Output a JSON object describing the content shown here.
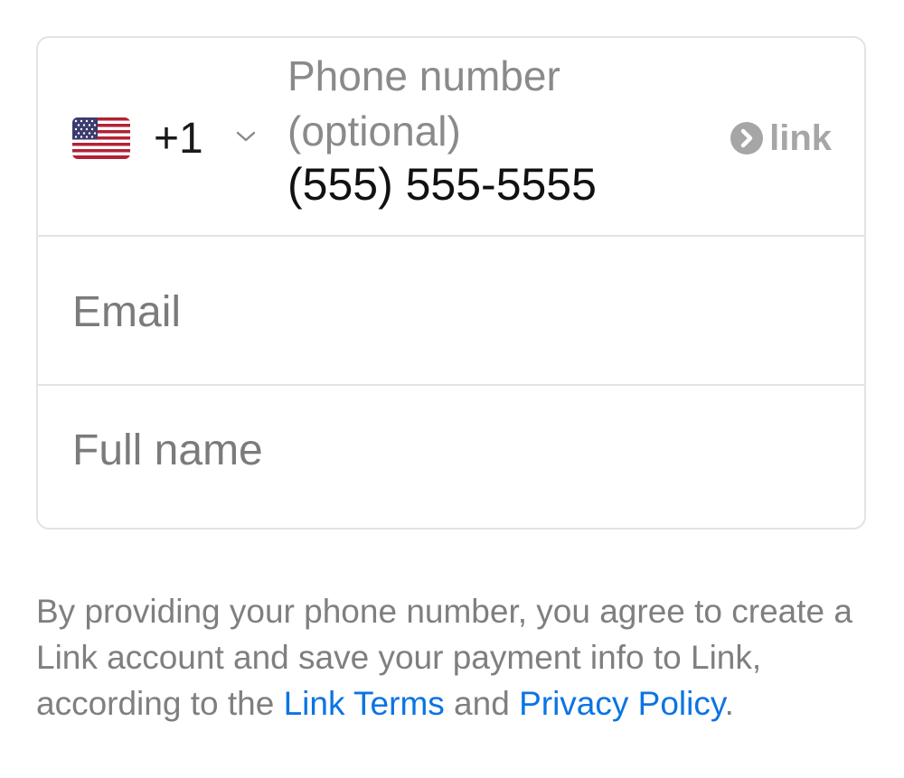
{
  "form": {
    "phone": {
      "country_code": "+1",
      "flag_icon": "us-flag-icon",
      "label": "Phone number (optional)",
      "value": "(555) 555-5555",
      "badge_text": "link",
      "badge_icon": "link-logo-icon"
    },
    "email": {
      "placeholder": "Email"
    },
    "full_name": {
      "placeholder": "Full name"
    }
  },
  "consent": {
    "text_before": "By providing your phone number, you agree to create a Link account and save your payment info to Link, according to the ",
    "terms_link": "Link Terms",
    "text_middle": " and ",
    "privacy_link": "Privacy Policy",
    "text_after": "."
  },
  "colors": {
    "link_blue": "#0b74e3",
    "placeholder_gray": "#7b7b7b",
    "border_gray": "#e3e3e3"
  }
}
